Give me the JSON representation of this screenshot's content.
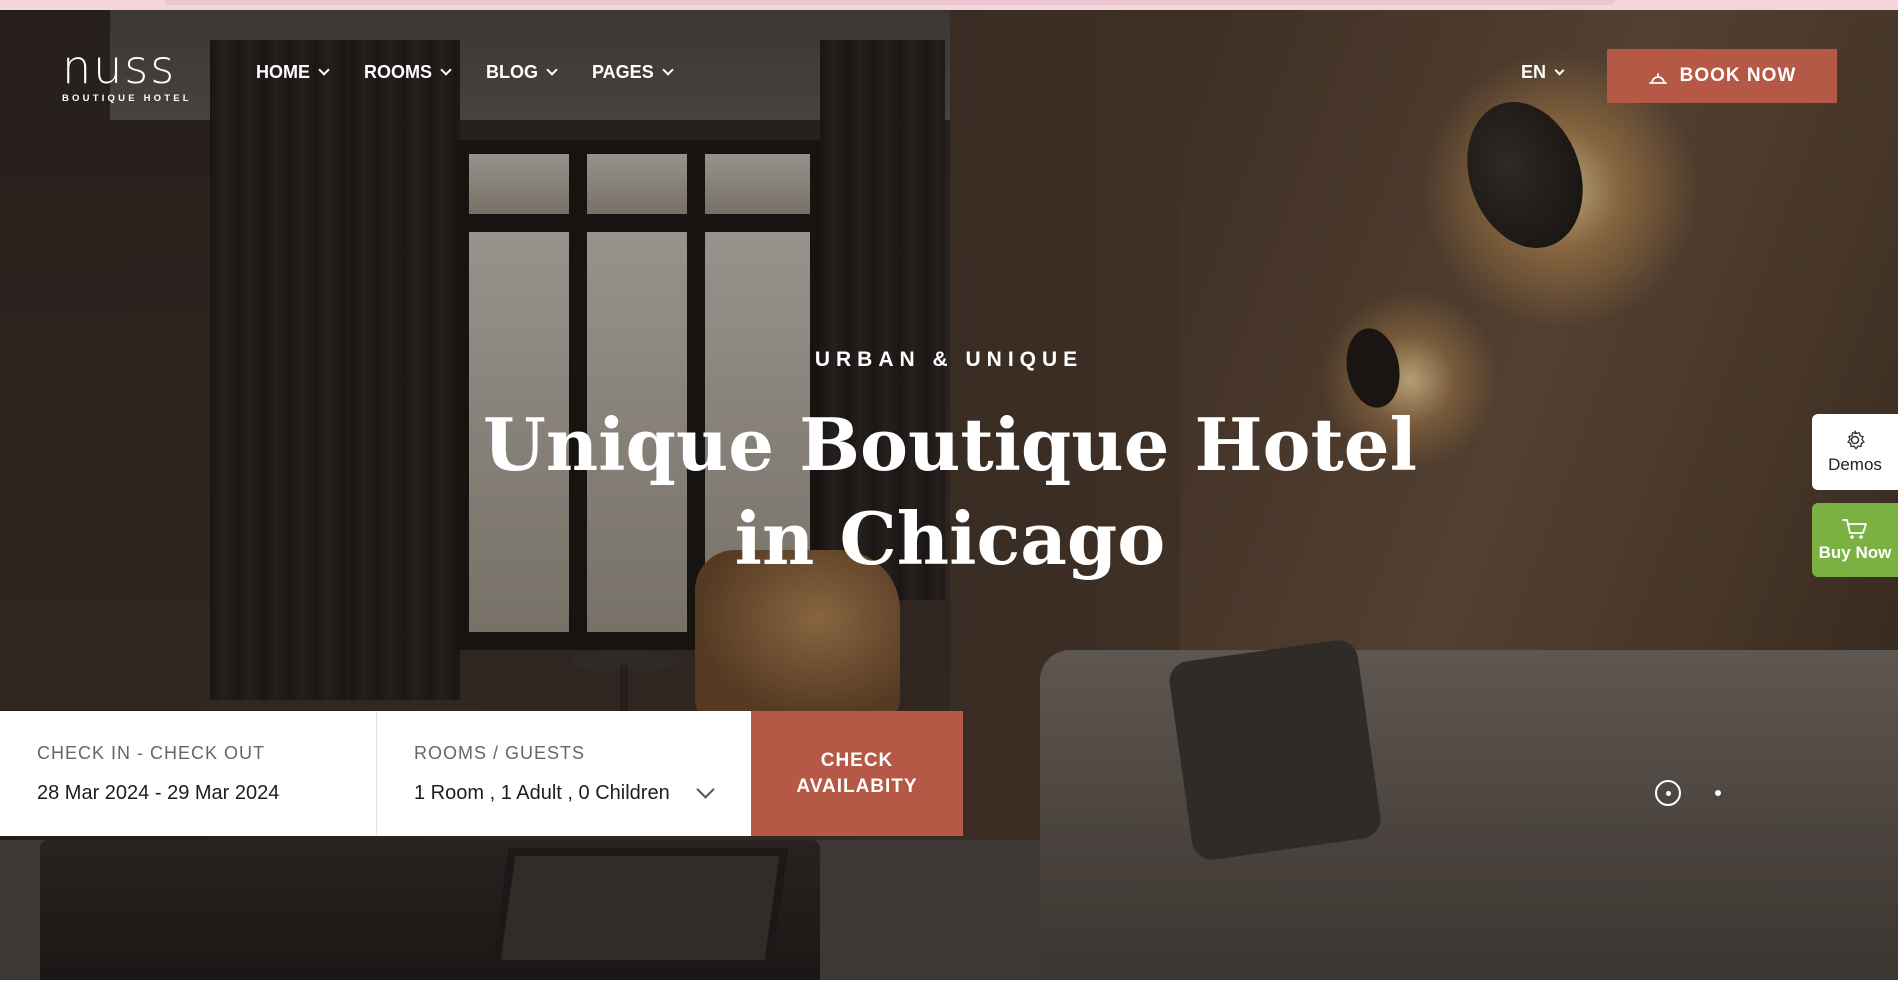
{
  "header": {
    "logo_main": "nuss",
    "logo_sub": "BOUTIQUE HOTEL",
    "nav": [
      {
        "label": "HOME"
      },
      {
        "label": "ROOMS"
      },
      {
        "label": "BLOG"
      },
      {
        "label": "PAGES"
      }
    ],
    "language": "EN",
    "book_label": "BOOK NOW"
  },
  "hero": {
    "eyebrow": "URBAN & UNIQUE",
    "headline_line1": "Unique Boutique Hotel",
    "headline_line2": "in Chicago",
    "slides_total": 2,
    "active_slide": 1
  },
  "side_widgets": {
    "demos_label": "Demos",
    "buy_label": "Buy Now",
    "demos_icon": "gear-icon",
    "buy_icon": "cart-icon",
    "buy_color": "#7bb043"
  },
  "booking": {
    "dates_label": "CHECK IN - CHECK OUT",
    "dates_value": "28 Mar 2024 - 29 Mar 2024",
    "guests_label": "ROOMS / GUESTS",
    "guests_value": "1 Room , 1 Adult , 0 Children",
    "check_line1": "CHECK",
    "check_line2": "AVAILABITY"
  },
  "colors": {
    "accent": "#b65846",
    "topbar": "#f5d6dd"
  }
}
